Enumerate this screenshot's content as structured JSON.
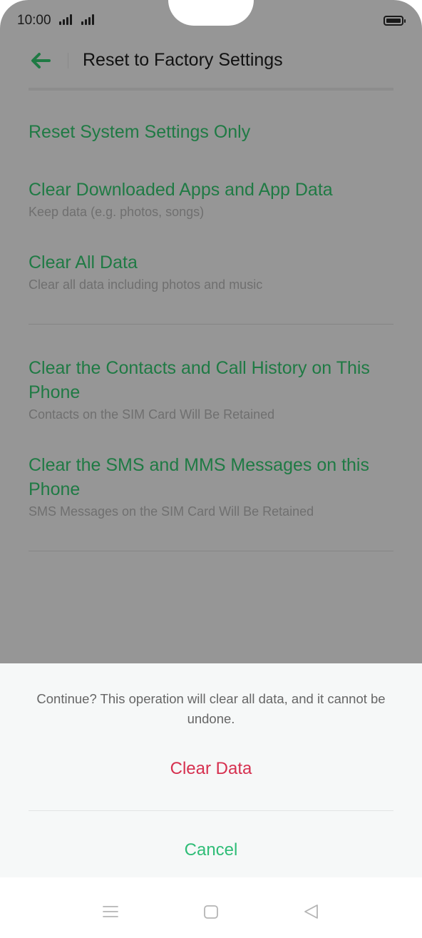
{
  "status_bar": {
    "time": "10:00"
  },
  "header": {
    "title": "Reset to Factory Settings"
  },
  "options": [
    {
      "label": "Reset System Settings Only",
      "sub": ""
    },
    {
      "label": "Clear Downloaded Apps and App Data",
      "sub": "Keep data (e.g. photos, songs)"
    },
    {
      "label": "Clear All Data",
      "sub": "Clear all data including photos and music"
    },
    {
      "label": "Clear the Contacts and Call History on This Phone",
      "sub": "Contacts on the SIM Card Will Be Retained"
    },
    {
      "label": "Clear the SMS and MMS Messages on this Phone",
      "sub": "SMS Messages on the SIM Card Will Be Retained"
    }
  ],
  "dialog": {
    "message": "Continue? This operation will clear all data, and it cannot be undone.",
    "confirm_label": "Clear Data",
    "cancel_label": "Cancel"
  },
  "colors": {
    "accent_green": "#1f7a44",
    "danger": "#d6304f",
    "cancel_green": "#2fbd77"
  },
  "icons": [
    "back-arrow-icon",
    "signal-icon",
    "battery-icon",
    "menu-icon",
    "home-icon",
    "back-triangle-icon"
  ]
}
